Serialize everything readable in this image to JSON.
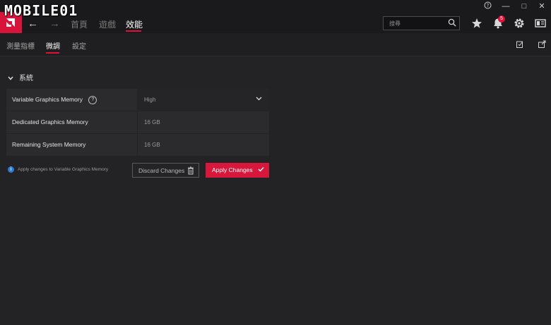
{
  "watermark": "MOBILE01",
  "window_controls": {
    "help": "?",
    "minimize": "—",
    "maximize": "□",
    "close": "✕"
  },
  "top_nav": {
    "tabs": [
      {
        "label": "首頁"
      },
      {
        "label": "遊戲"
      },
      {
        "label": "效能"
      }
    ],
    "active_tab": "效能",
    "search_placeholder": "搜尋",
    "notification_count": "5"
  },
  "sub_nav": {
    "tabs": [
      {
        "label": "測量指標"
      },
      {
        "label": "微調"
      },
      {
        "label": "設定"
      }
    ],
    "active_tab": "微調"
  },
  "section": {
    "title": "系統"
  },
  "settings": [
    {
      "label": "Variable Graphics Memory",
      "value": "High",
      "has_help": true,
      "dropdown": true
    },
    {
      "label": "Dedicated Graphics Memory",
      "value": "16 GB"
    },
    {
      "label": "Remaining System Memory",
      "value": "16 GB"
    }
  ],
  "footer": {
    "info_text": "Apply changes to Variable Graphics Memory",
    "discard_label": "Discard Changes",
    "apply_label": "Apply Changes"
  },
  "colors": {
    "accent": "#e0123a",
    "info": "#2f7bd8",
    "background": "#232325"
  }
}
